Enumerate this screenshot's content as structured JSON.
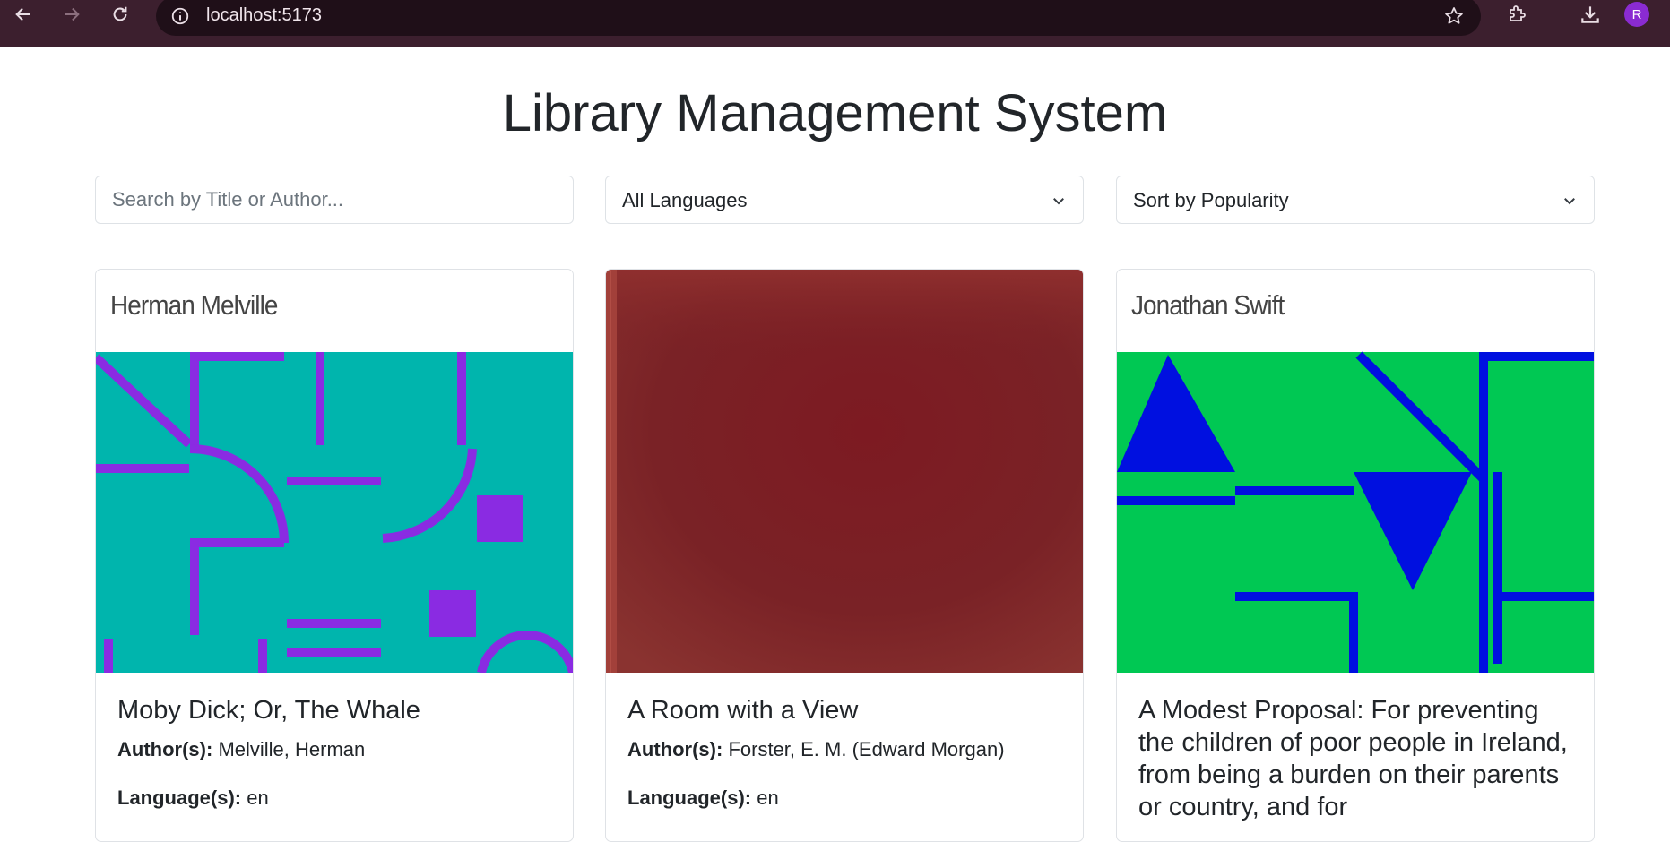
{
  "browser": {
    "url": "localhost:5173",
    "profile_initial": "R"
  },
  "page": {
    "title": "Library Management System"
  },
  "filters": {
    "search_placeholder": "Search by Title or Author...",
    "language_selected": "All Languages",
    "sort_selected": "Sort by Popularity"
  },
  "labels": {
    "authors": "Author(s):",
    "languages": "Language(s):"
  },
  "books": [
    {
      "cover_author": "Herman Melville",
      "title": "Moby Dick; Or, The Whale",
      "authors": "Melville, Herman",
      "languages": "en",
      "cover_colors": {
        "background": "#00b5ad",
        "shapes": "#8a2be2"
      }
    },
    {
      "cover_author": "",
      "title": "A Room with a View",
      "authors": "Forster, E. M. (Edward Morgan)",
      "languages": "en",
      "cover_colors": {
        "background": "#7a1f24"
      }
    },
    {
      "cover_author": "Jonathan Swift",
      "title": "A Modest Proposal: For preventing the children of poor people in Ireland, from being a burden on their parents or country, and for",
      "authors": "",
      "languages": "",
      "cover_colors": {
        "background": "#00c853",
        "shapes": "#0010e0"
      }
    }
  ]
}
